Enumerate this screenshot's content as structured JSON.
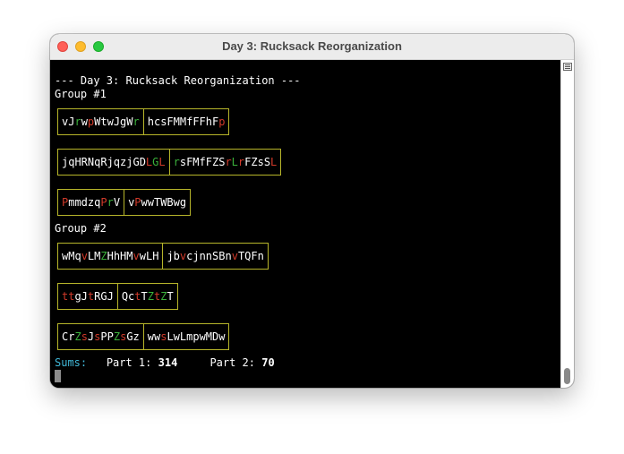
{
  "window": {
    "title": "Day 3: Rucksack Reorganization"
  },
  "terminal": {
    "header": "--- Day 3: Rucksack Reorganization ---",
    "groups": [
      {
        "label": "Group #1",
        "rucksacks": [
          {
            "left": [
              [
                "vJ",
                "w"
              ],
              [
                "r",
                "g"
              ],
              [
                "w",
                "w"
              ],
              [
                "p",
                "r"
              ],
              [
                "WtwJgW",
                "w"
              ],
              [
                "r",
                "g"
              ]
            ],
            "right": [
              [
                "hcsFMMfFFhF",
                "w"
              ],
              [
                "p",
                "r"
              ]
            ]
          },
          {
            "left": [
              [
                "jqHRNqRjqzjGD",
                "w"
              ],
              [
                "L",
                "r"
              ],
              [
                "G",
                "g"
              ],
              [
                "L",
                "r"
              ]
            ],
            "right": [
              [
                "r",
                "g"
              ],
              [
                "sFMfFZS",
                "w"
              ],
              [
                "r",
                "r"
              ],
              [
                "L",
                "g"
              ],
              [
                "r",
                "r"
              ],
              [
                "FZsS",
                "w"
              ],
              [
                "L",
                "r"
              ]
            ]
          },
          {
            "left": [
              [
                "P",
                "r"
              ],
              [
                "mmdzq",
                "w"
              ],
              [
                "P",
                "r"
              ],
              [
                "r",
                "g"
              ],
              [
                "V",
                "w"
              ]
            ],
            "right": [
              [
                "v",
                "w"
              ],
              [
                "P",
                "r"
              ],
              [
                "wwTWBwg",
                "w"
              ]
            ]
          }
        ]
      },
      {
        "label": "Group #2",
        "rucksacks": [
          {
            "left": [
              [
                "wMq",
                "w"
              ],
              [
                "v",
                "r"
              ],
              [
                "LM",
                "w"
              ],
              [
                "Z",
                "g"
              ],
              [
                "HhHM",
                "w"
              ],
              [
                "v",
                "r"
              ],
              [
                "wLH",
                "w"
              ]
            ],
            "right": [
              [
                "jb",
                "w"
              ],
              [
                "v",
                "r"
              ],
              [
                "cjnnSBn",
                "w"
              ],
              [
                "v",
                "r"
              ],
              [
                "TQFn",
                "w"
              ]
            ]
          },
          {
            "left": [
              [
                "tt",
                "r"
              ],
              [
                "gJ",
                "w"
              ],
              [
                "t",
                "r"
              ],
              [
                "RGJ",
                "w"
              ]
            ],
            "right": [
              [
                "Qc",
                "w"
              ],
              [
                "t",
                "r"
              ],
              [
                "T",
                "w"
              ],
              [
                "Z",
                "g"
              ],
              [
                "t",
                "r"
              ],
              [
                "Z",
                "g"
              ],
              [
                "T",
                "w"
              ]
            ]
          },
          {
            "left": [
              [
                "Cr",
                "w"
              ],
              [
                "Z",
                "g"
              ],
              [
                "s",
                "r"
              ],
              [
                "J",
                "w"
              ],
              [
                "s",
                "r"
              ],
              [
                "PP",
                "w"
              ],
              [
                "Z",
                "g"
              ],
              [
                "s",
                "r"
              ],
              [
                "Gz",
                "w"
              ]
            ],
            "right": [
              [
                "ww",
                "w"
              ],
              [
                "s",
                "r"
              ],
              [
                "LwLmpwMDw",
                "w"
              ]
            ]
          }
        ]
      }
    ],
    "sums": {
      "label": "Sums:",
      "part1_label": "Part 1:",
      "part1_value": "314",
      "part2_label": "Part 2:",
      "part2_value": "70"
    }
  },
  "colors": {
    "priority_red": "#d23a2a",
    "badge_green": "#3bb13b",
    "box_border": "#b7b52a",
    "sums_label": "#40b8d8"
  },
  "icons": [
    "close-icon",
    "minimize-icon",
    "zoom-icon",
    "scrollbar-menu-icon"
  ]
}
